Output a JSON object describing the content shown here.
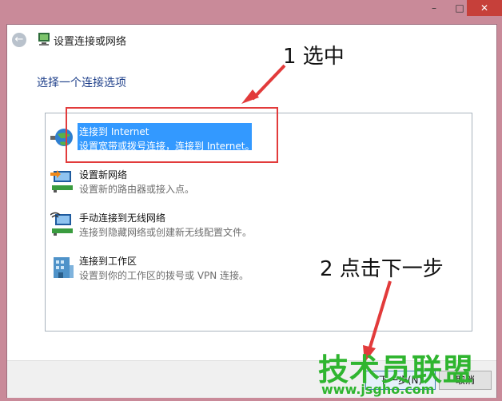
{
  "window": {
    "title": "设置连接或网络",
    "caption_minimize": "–",
    "caption_maximize": "□",
    "caption_close": "✕",
    "back_glyph": "←"
  },
  "main": {
    "heading": "选择一个连接选项"
  },
  "options": [
    {
      "title": "连接到 Internet",
      "desc": "设置宽带或拨号连接，连接到 Internet。",
      "icon": "globe-internet-icon",
      "selected": true
    },
    {
      "title": "设置新网络",
      "desc": "设置新的路由器或接入点。",
      "icon": "new-network-icon",
      "selected": false
    },
    {
      "title": "手动连接到无线网络",
      "desc": "连接到隐藏网络或创建新无线配置文件。",
      "icon": "wireless-network-icon",
      "selected": false
    },
    {
      "title": "连接到工作区",
      "desc": "设置到你的工作区的拨号或 VPN 连接。",
      "icon": "workplace-icon",
      "selected": false
    }
  ],
  "footer": {
    "next_label": "下一步(N)",
    "cancel_label": "取消"
  },
  "annotations": {
    "step1": "1 选中",
    "step2": "2 点击下一步",
    "color": "#e23b3b"
  },
  "watermark": {
    "main": "技术员联盟",
    "url": "www.jsgho.com",
    "color": "#2fb52f"
  }
}
